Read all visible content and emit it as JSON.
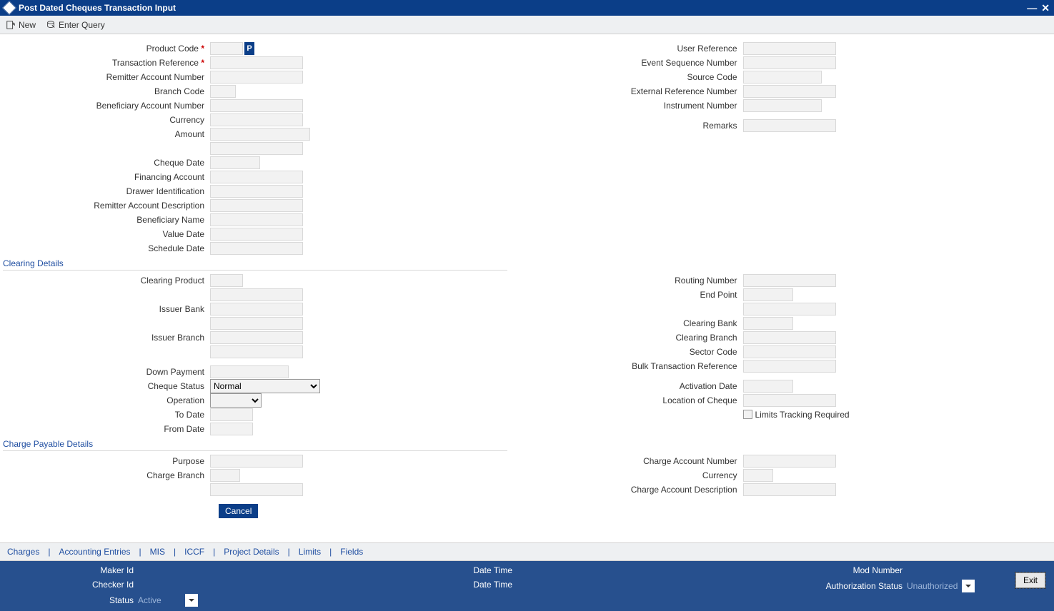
{
  "window": {
    "title": "Post Dated Cheques Transaction Input"
  },
  "toolbar": {
    "new": "New",
    "enter_query": "Enter Query"
  },
  "main": {
    "left": {
      "product_code": "Product Code",
      "txn_ref": "Transaction Reference",
      "remitter_acc": "Remitter Account Number",
      "branch_code": "Branch Code",
      "benef_acc": "Beneficiary Account Number",
      "currency": "Currency",
      "amount": "Amount",
      "cheque_date": "Cheque Date",
      "fin_acc": "Financing Account",
      "drawer_id": "Drawer Identification",
      "remitter_desc": "Remitter Account Description",
      "benef_name": "Beneficiary Name",
      "value_date": "Value Date",
      "schedule_date": "Schedule Date"
    },
    "right": {
      "user_ref": "User Reference",
      "evt_seq": "Event Sequence Number",
      "source_code": "Source Code",
      "ext_ref": "External Reference Number",
      "instr_num": "Instrument Number",
      "remarks": "Remarks"
    }
  },
  "clearing": {
    "header": "Clearing Details",
    "left": {
      "clearing_product": "Clearing Product",
      "issuer_bank": "Issuer Bank",
      "issuer_branch": "Issuer Branch",
      "down_payment": "Down Payment",
      "cheque_status": "Cheque Status",
      "cheque_status_val": "Normal",
      "operation": "Operation",
      "operation_val": "",
      "to_date": "To Date",
      "from_date": "From Date"
    },
    "right": {
      "routing_no": "Routing Number",
      "end_point": "End Point",
      "clearing_bank": "Clearing Bank",
      "clearing_branch": "Clearing Branch",
      "sector_code": "Sector Code",
      "bulk_txn_ref": "Bulk Transaction Reference",
      "activation_date": "Activation Date",
      "cheque_location": "Location of Cheque",
      "limits_tracking": "Limits Tracking Required"
    }
  },
  "charge": {
    "header": "Charge Payable Details",
    "left": {
      "purpose": "Purpose",
      "charge_branch": "Charge Branch"
    },
    "right": {
      "charge_acc_no": "Charge Account Number",
      "currency": "Currency",
      "charge_acc_desc": "Charge Account Description"
    },
    "cancel": "Cancel"
  },
  "bottom_tabs": [
    "Charges",
    "Accounting Entries",
    "MIS",
    "ICCF",
    "Project Details",
    "Limits",
    "Fields"
  ],
  "status": {
    "maker_id": "Maker Id",
    "checker_id": "Checker Id",
    "status": "Status",
    "status_val": "Active",
    "date_time1": "Date Time",
    "date_time2": "Date Time",
    "mod_number": "Mod Number",
    "auth_status": "Authorization Status",
    "auth_status_val": "Unauthorized",
    "exit": "Exit"
  },
  "p_icon": "P"
}
